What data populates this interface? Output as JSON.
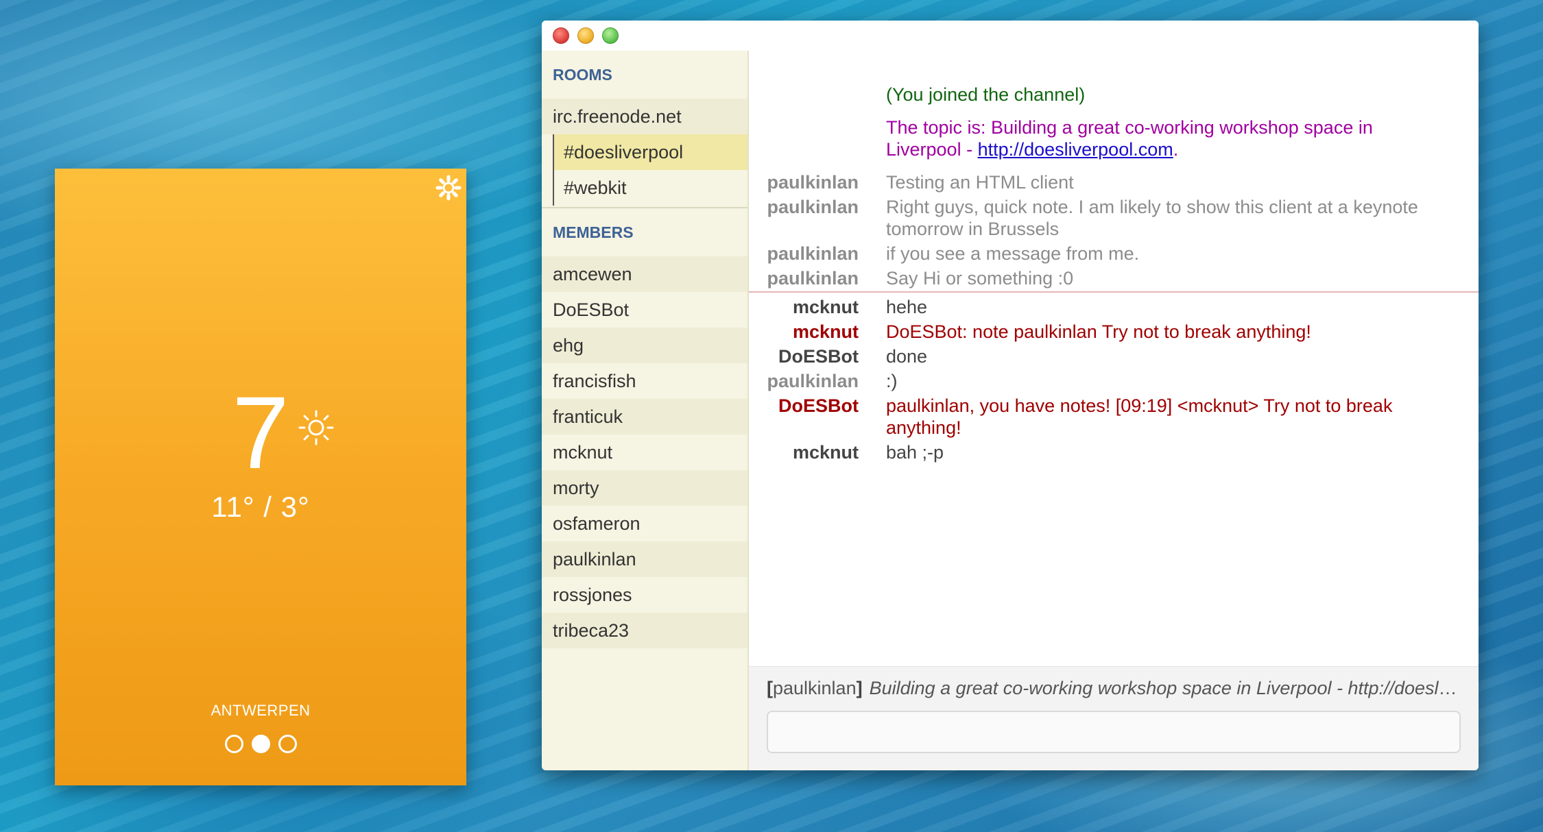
{
  "weather": {
    "temperature": "7",
    "high_low": "11° / 3°",
    "city": "ANTWERPEN",
    "condition_icon": "sun-icon",
    "settings_icon": "gear-icon",
    "pager_pages": 3,
    "pager_active_index": 1
  },
  "chat": {
    "sidebar": {
      "rooms_heading": "ROOMS",
      "server": "irc.freenode.net",
      "channels": [
        "#doesliverpool",
        "#webkit"
      ],
      "selected_channel": "#doesliverpool",
      "members_heading": "MEMBERS",
      "members": [
        "amcewen",
        "DoESBot",
        "ehg",
        "francisfish",
        "franticuk",
        "mcknut",
        "morty",
        "osfameron",
        "paulkinlan",
        "rossjones",
        "tribeca23"
      ]
    },
    "messages": {
      "joined": "(You joined the channel)",
      "topic_prefix": "The topic is: Building a great co-working workshop space in Liverpool - ",
      "topic_link": "http://doesliverpool.com",
      "topic_suffix": ".",
      "lines": [
        {
          "nick": "paulkinlan",
          "text": "Testing an HTML client"
        },
        {
          "nick": "paulkinlan",
          "text": "Right guys, quick note.  I am likely to show this client at a keynote tomorrow in Brussels"
        },
        {
          "nick": "paulkinlan",
          "text": "if you see a message from me."
        },
        {
          "nick": "paulkinlan",
          "text": "Say Hi or something :0"
        },
        {
          "nick": "mcknut",
          "text": "hehe"
        },
        {
          "nick": "mcknut",
          "text": "DoESBot: note paulkinlan Try not to break anything!"
        },
        {
          "nick": "DoESBot",
          "text": "done"
        },
        {
          "nick": "paulkinlan",
          "text": ":)"
        },
        {
          "nick": "DoESBot",
          "text": "paulkinlan, you have notes! [09:19] <mcknut> Try not to break anything!"
        },
        {
          "nick": "mcknut",
          "text": "bah ;-p"
        }
      ]
    },
    "footer": {
      "open_bracket": "[",
      "current_nick": "paulkinlan",
      "close_bracket": "]",
      "topic": "Building a great co-working workshop space in Liverpool - http://doesliverpool.com",
      "input_value": ""
    },
    "colors": {
      "accent_heading": "#3d6296",
      "sidebar_bg": "#f6f4e2",
      "selected_bg": "#f0e8a4",
      "highlight_red": "#a00000",
      "topic_purple": "#a000a0",
      "join_green": "#116611"
    }
  }
}
